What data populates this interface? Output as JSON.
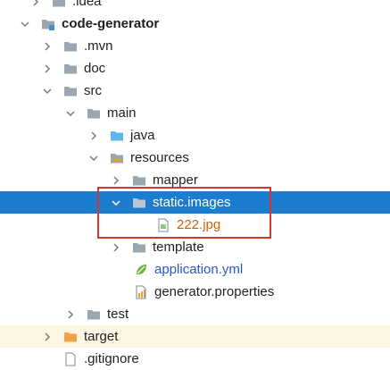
{
  "project_tree": {
    "items": [
      {
        "label": ".idea"
      },
      {
        "label": "code-generator"
      },
      {
        "label": ".mvn"
      },
      {
        "label": "doc"
      },
      {
        "label": "src"
      },
      {
        "label": "main"
      },
      {
        "label": "java"
      },
      {
        "label": "resources"
      },
      {
        "label": "mapper"
      },
      {
        "label": "static.images"
      },
      {
        "label": "222.jpg"
      },
      {
        "label": "template"
      },
      {
        "label": "application.yml"
      },
      {
        "label": "generator.properties"
      },
      {
        "label": "test"
      },
      {
        "label": "target"
      },
      {
        "label": ".gitignore"
      }
    ]
  },
  "colors": {
    "selection": "#1c7ccf",
    "highlight_border": "#d9342b",
    "folder": "#9aa7b0",
    "source_folder": "#5bb8e8",
    "excluded_folder": "#f0a14a",
    "link_text": "#2a56c6",
    "image_file_text": "#c9630a"
  }
}
